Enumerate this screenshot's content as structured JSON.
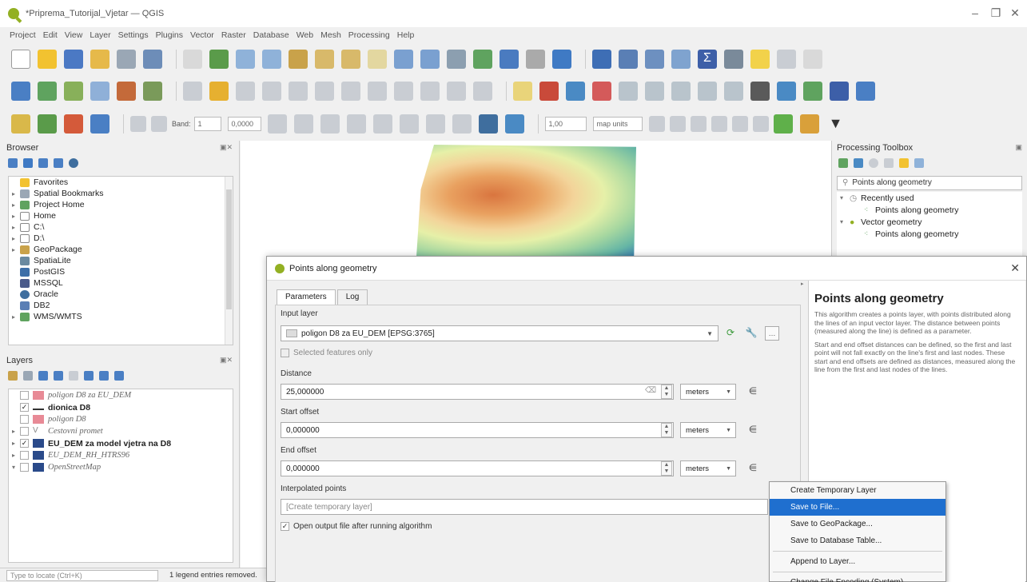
{
  "window": {
    "title": "*Priprema_Tutorijal_Vjetar — QGIS"
  },
  "menubar": [
    "Project",
    "Edit",
    "View",
    "Layer",
    "Settings",
    "Plugins",
    "Vector",
    "Raster",
    "Database",
    "Web",
    "Mesh",
    "Processing",
    "Help"
  ],
  "toolbar3": {
    "band_label": "Band:",
    "band_value": "1",
    "value_box": "0,0000",
    "scale_value": "1,00",
    "units_value": "map units"
  },
  "browser": {
    "title": "Browser",
    "items": [
      "Favorites",
      "Spatial Bookmarks",
      "Project Home",
      "Home",
      "C:\\",
      "D:\\",
      "GeoPackage",
      "SpatiaLite",
      "PostGIS",
      "MSSQL",
      "Oracle",
      "DB2",
      "WMS/WMTS"
    ]
  },
  "layers": {
    "title": "Layers",
    "items": [
      {
        "label": "poligon D8 za EU_DEM",
        "checked": false
      },
      {
        "label": "dionica D8",
        "checked": true
      },
      {
        "label": "poligon D8",
        "checked": false
      },
      {
        "label": "Cestovni promet",
        "checked": false
      },
      {
        "label": "EU_DEM za model vjetra na D8",
        "checked": true
      },
      {
        "label": "EU_DEM_RH_HTRS96",
        "checked": false
      },
      {
        "label": "OpenStreetMap",
        "checked": false
      }
    ]
  },
  "status": {
    "locator_placeholder": "Type to locate (Ctrl+K)",
    "message": "1 legend entries removed."
  },
  "toolbox": {
    "title": "Processing Toolbox",
    "search_value": "Points along geometry",
    "groups": [
      {
        "label": "Recently used",
        "child": "Points along geometry"
      },
      {
        "label": "Vector geometry",
        "child": "Points along geometry"
      }
    ]
  },
  "dialog": {
    "title": "Points along geometry",
    "tabs": [
      "Parameters",
      "Log"
    ],
    "input_layer_label": "Input layer",
    "input_layer_value": "poligon D8 za EU_DEM [EPSG:3765]",
    "selected_only_label": "Selected features only",
    "distance_label": "Distance",
    "distance_value": "25,000000",
    "distance_unit": "meters",
    "start_offset_label": "Start offset",
    "start_offset_value": "0,000000",
    "start_offset_unit": "meters",
    "end_offset_label": "End offset",
    "end_offset_value": "0,000000",
    "end_offset_unit": "meters",
    "interpolated_label": "Interpolated points",
    "interpolated_placeholder": "[Create temporary layer]",
    "open_output_label": "Open output file after running algorithm",
    "help_title": "Points along geometry",
    "help_p1": "This algorithm creates a points layer, with points distributed along the lines of an input vector layer. The distance between points (measured along the line) is defined as a parameter.",
    "help_p2": "Start and end offset distances can be defined, so the first and last point will not fall exactly on the line's first and last nodes. These start and end offsets are defined as distances, measured along the line from the first and last nodes of the lines."
  },
  "context_menu": {
    "items": [
      "Create Temporary Layer",
      "Save to File...",
      "Save to GeoPackage...",
      "Save to Database Table...",
      "Append to Layer...",
      "Change File Encoding (System)..."
    ],
    "highlighted_index": 1,
    "highlight_color": "#1f6fcf"
  },
  "colors": {
    "qgis_green": "#93b023",
    "selection_blue": "#1f6fcf"
  }
}
